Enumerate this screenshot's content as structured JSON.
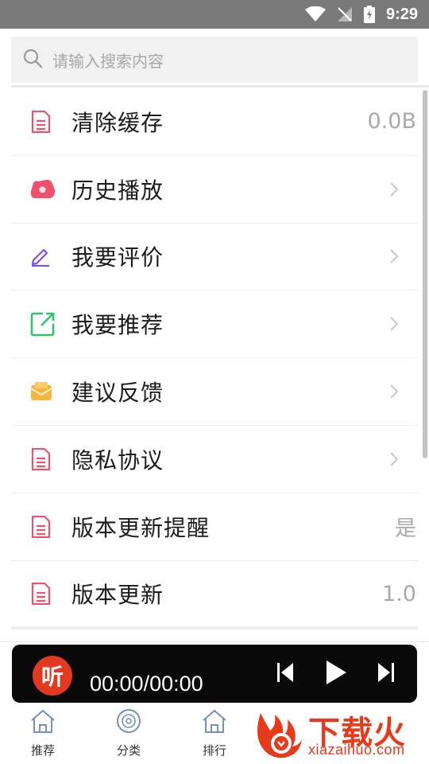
{
  "status_bar": {
    "time": "9:29"
  },
  "search": {
    "placeholder": "请输入搜索内容"
  },
  "settings": [
    {
      "label": "清除缓存",
      "value": "0.0B",
      "icon": "document-icon",
      "icon_color": "#f0506e",
      "has_chevron": false
    },
    {
      "label": "历史播放",
      "value": "",
      "icon": "history-cloud-icon",
      "icon_color": "#f0506e",
      "has_chevron": true
    },
    {
      "label": "我要评价",
      "value": "",
      "icon": "pencil-icon",
      "icon_color": "#7a4ff0",
      "has_chevron": true
    },
    {
      "label": "我要推荐",
      "value": "",
      "icon": "share-icon",
      "icon_color": "#2cc56a",
      "has_chevron": true
    },
    {
      "label": "建议反馈",
      "value": "",
      "icon": "envelope-icon",
      "icon_color": "#f5b63b",
      "has_chevron": true
    },
    {
      "label": "隐私协议",
      "value": "",
      "icon": "document-icon",
      "icon_color": "#f0506e",
      "has_chevron": true
    },
    {
      "label": "版本更新提醒",
      "value": "是",
      "icon": "document-icon",
      "icon_color": "#f0506e",
      "has_chevron": false
    },
    {
      "label": "版本更新",
      "value": "1.0",
      "icon": "document-icon",
      "icon_color": "#f0506e",
      "has_chevron": false
    }
  ],
  "player": {
    "logo_text": "听",
    "time": "00:00/00:00",
    "accent": "#e23a20"
  },
  "tabs": [
    {
      "label": "推荐",
      "icon": "home-icon"
    },
    {
      "label": "分类",
      "icon": "disc-icon"
    },
    {
      "label": "排行",
      "icon": "home-icon"
    }
  ],
  "watermark": {
    "name": "下载火",
    "url": "xiazaihuo.com",
    "color": "#e63a1a"
  }
}
